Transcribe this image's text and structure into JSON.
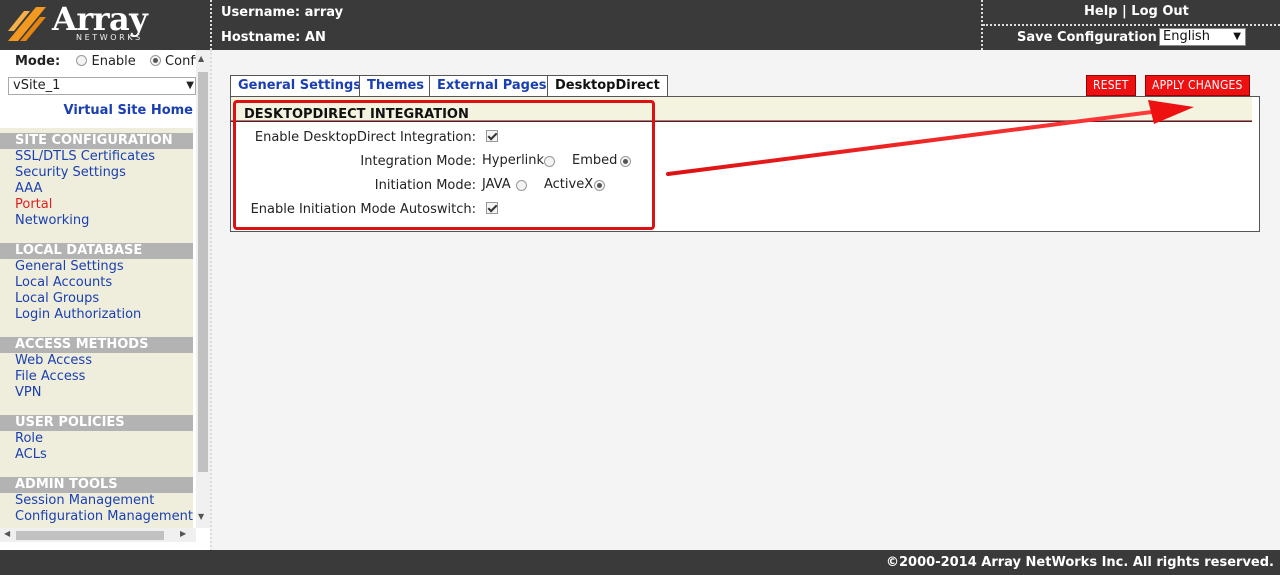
{
  "brand": {
    "name": "Array",
    "sub": "NETWORKS"
  },
  "header": {
    "username": "Username: array",
    "hostname": "Hostname: AN",
    "help": "Help",
    "separator": "|",
    "logout": "Log Out",
    "save": "Save Configuration",
    "language": "English"
  },
  "sidebar": {
    "mode_label": "Mode:",
    "mode_enable": "Enable",
    "mode_config": "Config",
    "vsite": "vSite_1",
    "vsite_home": "Virtual Site Home",
    "sections": [
      {
        "title": "SITE CONFIGURATION",
        "items": [
          "SSL/DTLS Certificates",
          "Security Settings",
          "AAA",
          "Portal",
          "Networking"
        ]
      },
      {
        "title": "LOCAL DATABASE",
        "items": [
          "General Settings",
          "Local Accounts",
          "Local Groups",
          "Login Authorization"
        ]
      },
      {
        "title": "ACCESS METHODS",
        "items": [
          "Web Access",
          "File Access",
          "VPN"
        ]
      },
      {
        "title": "USER POLICIES",
        "items": [
          "Role",
          "ACLs"
        ]
      },
      {
        "title": "ADMIN TOOLS",
        "items": [
          "Session Management",
          "Configuration Management"
        ]
      }
    ],
    "active_item": "Portal"
  },
  "tabs": [
    "General Settings",
    "Themes",
    "External Pages",
    "DesktopDirect"
  ],
  "active_tab": "DesktopDirect",
  "buttons": {
    "reset": "RESET",
    "apply": "APPLY CHANGES"
  },
  "panel": {
    "title": "DESKTOPDIRECT INTEGRATION",
    "fields": {
      "enable_integration": {
        "label": "Enable DesktopDirect Integration:",
        "checked": true
      },
      "integration_mode": {
        "label": "Integration Mode:",
        "options": [
          "Hyperlink",
          "Embed"
        ],
        "selected": "Embed"
      },
      "initiation_mode": {
        "label": "Initiation Mode:",
        "options": [
          "JAVA",
          "ActiveX"
        ],
        "selected": "ActiveX"
      },
      "autoswitch": {
        "label": "Enable Initiation Mode Autoswitch:",
        "checked": true
      }
    }
  },
  "annotation_color": "#dd1111",
  "footer": "©2000-2014 Array NetWorks Inc. All rights reserved."
}
